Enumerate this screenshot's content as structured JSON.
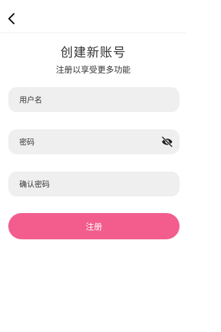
{
  "header": {
    "back_icon": "chevron-left-icon"
  },
  "page": {
    "title": "创建新账号",
    "subtitle": "注册以享受更多功能"
  },
  "form": {
    "username": {
      "placeholder": "用户名",
      "value": ""
    },
    "password": {
      "placeholder": "密码",
      "value": "",
      "toggle_icon": "eye-off-icon"
    },
    "confirm_password": {
      "placeholder": "确认密码",
      "value": ""
    },
    "submit_label": "注册"
  },
  "colors": {
    "accent": "#f25d8e",
    "field_background": "#efefef"
  }
}
